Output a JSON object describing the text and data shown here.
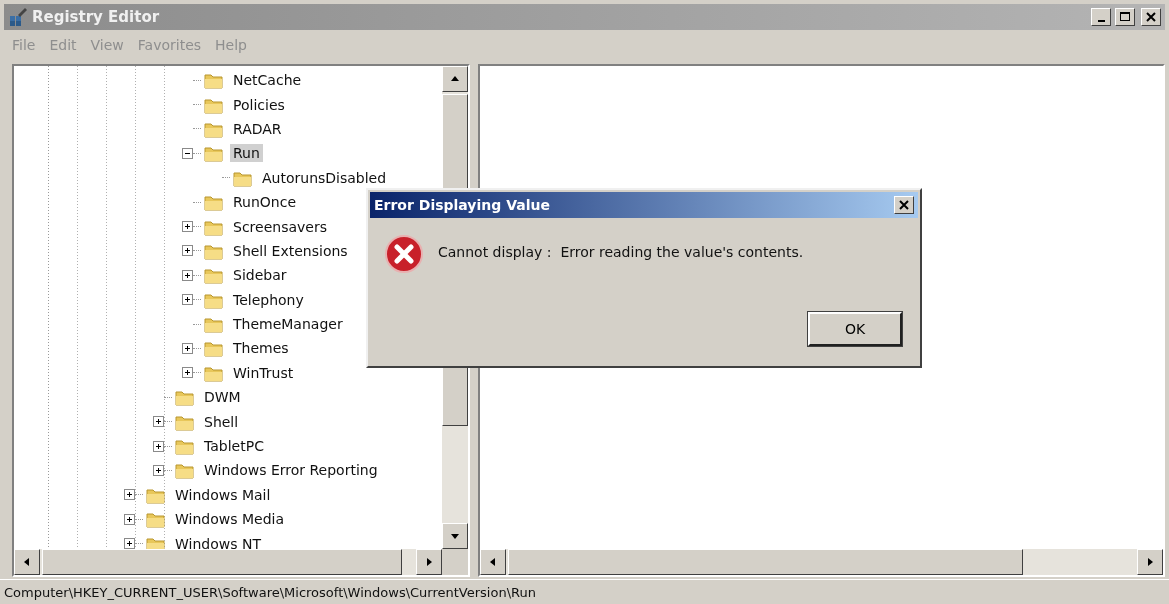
{
  "window": {
    "title": "Registry Editor",
    "active": false
  },
  "menu": [
    "File",
    "Edit",
    "View",
    "Favorites",
    "Help"
  ],
  "tree": {
    "items": [
      {
        "children": [
          {
            "children": [
              {
                "label": "NetCache",
                "selected": false
              },
              {
                "label": "Policies",
                "selected": false
              },
              {
                "label": "RADAR",
                "selected": false
              },
              {
                "label": "Run",
                "selected": true,
                "expanded": true,
                "children": [
                  {
                    "label": "AutorunsDisabled",
                    "selected": false
                  }
                ]
              },
              {
                "label": "RunOnce",
                "selected": false
              },
              {
                "label": "Screensavers",
                "selected": false,
                "expanded": false
              },
              {
                "label": "Shell Extensions",
                "selected": false,
                "expanded": false
              },
              {
                "label": "Sidebar",
                "selected": false,
                "expanded": false
              },
              {
                "label": "Telephony",
                "selected": false,
                "expanded": false
              },
              {
                "label": "ThemeManager",
                "selected": false
              },
              {
                "label": "Themes",
                "selected": false,
                "expanded": false
              },
              {
                "label": "WinTrust",
                "selected": false,
                "expanded": false
              }
            ]
          },
          {
            "label": "DWM",
            "selected": false
          },
          {
            "label": "Shell",
            "selected": false,
            "expanded": false
          },
          {
            "label": "TabletPC",
            "selected": false,
            "expanded": false
          },
          {
            "label": "Windows Error Reporting",
            "selected": false,
            "expanded": false
          }
        ]
      },
      {
        "label": "Windows Mail",
        "selected": false,
        "expanded": false
      },
      {
        "label": "Windows Media",
        "selected": false,
        "expanded": false
      },
      {
        "label": "Windows NT",
        "selected": false,
        "expanded": false
      }
    ]
  },
  "dialog": {
    "title": "Error Displaying Value",
    "message": "Cannot display :  Error reading the value's contents.",
    "buttons": [
      "OK"
    ]
  },
  "status_bar": "Computer\\HKEY_CURRENT_USER\\Software\\Microsoft\\Windows\\CurrentVersion\\Run"
}
